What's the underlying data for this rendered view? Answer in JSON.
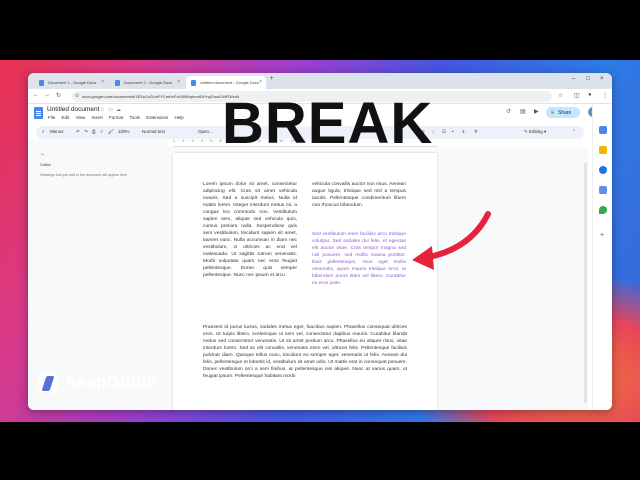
{
  "browser": {
    "tabs": [
      {
        "label": "Document 1 - Google Docs"
      },
      {
        "label": "Document 2 - Google Docs"
      },
      {
        "label": "Untitled document - Google Docs"
      }
    ],
    "url": "docs.google.com/document/d/1ESuSvD1wFYCmHvFxK5BWqhmdDtYrqZhro6J4fFl3/edit"
  },
  "doc": {
    "title": "Untitled document",
    "menu": [
      "File",
      "Edit",
      "View",
      "Insert",
      "Format",
      "Tools",
      "Extensions",
      "Help"
    ],
    "share_label": "Share",
    "editing_label": "Editing"
  },
  "toolbar": {
    "search_menus": "Menus",
    "zoom": "100%",
    "style": "Normal text",
    "font": "Open..."
  },
  "ruler": "1 · · · 2 · · · 3 · · · 4 · · · 5 · · · 6 · · · 7 · · · 8 · · · 9 · · · 10 · · · 11 · · · 12 · · · 13 · · · 14 · · · 15 · · · 16 · · · 17 · · · 18",
  "outline": {
    "title": "Outline",
    "message": "Headings that you add to the document will appear here."
  },
  "body": {
    "col1": "Lorem ipsum dolor sit amet, consectetur adipiscing elit. Cras sit amet vehicula mauris. Sed a suscipit metus. Nulla id mattis lorem. Integer interdum metus mi, a congue leo commodo non. Vestibulum sapien sem, aliquet sed vehicula quis, cursus pretium nulla. Suspendisse quis sem vestibulum, tincidunt sapien sit amet, laoreet nunc. Nulla accumsan in diam nec vestibulum, in ultricies ac erat vel malesuada. Ut sagittis rutrum venenatis. Morbi vulputate quam nec eros feugiat pellentesque. Donec quis semper pellentesque. Nunc nec ipsum et arcu",
    "col2": "vehicula convallis auctor non risus. Aenean augue ligula, tristique sed nisl a tempus iaculis. Pellentesque condimentum libero non rhoncus bibendum.",
    "col2_highlight": "Sed vestibulum enim facilisis arcu tristique volutpat. Sed sodales dui felis, et egestas elit auctor vitae. Cras tempor magna sed nisl posuere, sed mollis massa porttitor. Duis pellentesque, risus eget mollis venenatis, quam mauris tristique eros, at bibendum purus diam vel libero. Curabitur eu eros justo.",
    "col3": "Praesent id purus luctus, sodales metus eget, faucibus sapien. Phasellus consequat ultrices eros. Ut turpis libero, scelerisque ut sem vel, consectetur dapibus mauris. Curabitur blandit metus sed consectetur venenatis. Ut sit amet pretium arcu. Phasellus eu aliquet risus, vitae interdum lorem. Sed ac elit convallis, venenatis enim vel, ultrices felis. Pellentesque facilisis pulvinar diam. Quisque tellus nunc, tincidunt eu semper eget, venenatis ut felis. Aenean dui felis, pellentesque et lobortis id, vestibulum sit amet odio. Ut mattis erat in consequat posuere. Donec vestibulum orci a sem finibus, at pellentesque nisi aliquet. Nunc at varius quam, ut feugiat ipsum. Pellentesque habitant morbi"
  },
  "overlay": {
    "headline": "BREAK",
    "logo_text": "AsapGuide",
    "arrow_color": "#e5233a"
  },
  "colors": {
    "share_bg": "#c2e7ff",
    "doc_blue": "#4a87e8",
    "highlight_text": "#8a5fd4"
  }
}
